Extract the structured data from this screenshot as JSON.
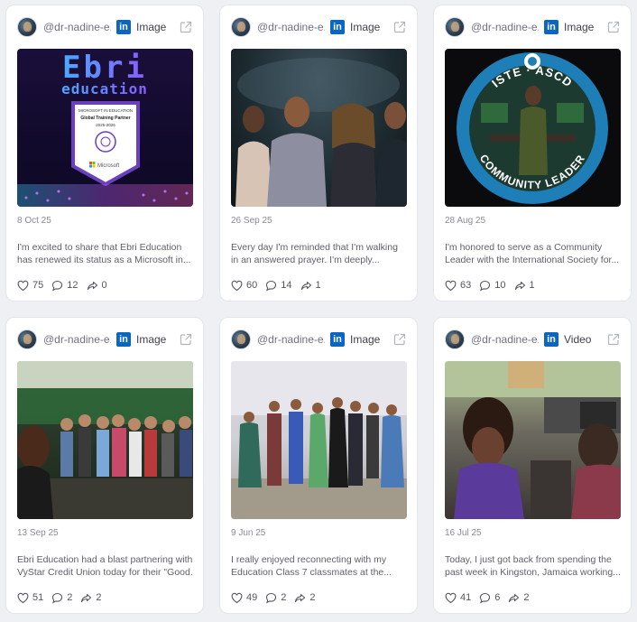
{
  "posts": [
    {
      "handle": "@dr-nadine-e...",
      "platform_icon": "linkedin-icon",
      "type": "Image",
      "media": "ebri",
      "media_text": {
        "brand_line1": "Ebri",
        "brand_line2": "education",
        "badge_top": "MICROSOFT IN EDUCATION",
        "badge_mid": "Global Training Partner",
        "badge_years": "2025-2026",
        "badge_brand": "Microsoft"
      },
      "date": "8 Oct 25",
      "excerpt_line1": "I'm excited to share that Ebri Education",
      "excerpt_line2": "has renewed its status as a Microsoft in...",
      "likes": "75",
      "comments": "12",
      "shares": "0"
    },
    {
      "handle": "@dr-nadine-e...",
      "platform_icon": "linkedin-icon",
      "type": "Image",
      "media": "people",
      "date": "26 Sep 25",
      "excerpt_line1": "Every day I'm reminded that I'm walking",
      "excerpt_line2": "in an answered prayer. I'm deeply...",
      "likes": "60",
      "comments": "14",
      "shares": "1"
    },
    {
      "handle": "@dr-nadine-e...",
      "platform_icon": "linkedin-icon",
      "type": "Image",
      "media": "iste",
      "media_text": {
        "ring_top": "ISTE · ASCD",
        "ring_bottom": "COMMUNITY LEADER"
      },
      "date": "28 Aug 25",
      "excerpt_line1": "I'm honored to serve as a Community",
      "excerpt_line2": "Leader with the International Society for...",
      "likes": "63",
      "comments": "10",
      "shares": "1"
    },
    {
      "handle": "@dr-nadine-e...",
      "platform_icon": "linkedin-icon",
      "type": "Image",
      "media": "party",
      "date": "13 Sep 25",
      "excerpt_line1": "Ebri Education had a blast partnering with",
      "excerpt_line2": "VyStar Credit Union today for their \"Good...",
      "likes": "51",
      "comments": "2",
      "shares": "2"
    },
    {
      "handle": "@dr-nadine-e...",
      "platform_icon": "linkedin-icon",
      "type": "Image",
      "media": "group",
      "date": "9 Jun 25",
      "excerpt_line1": "I really enjoyed reconnecting with my",
      "excerpt_line2": "Education Class 7 classmates at the...",
      "likes": "49",
      "comments": "2",
      "shares": "2"
    },
    {
      "handle": "@dr-nadine-e...",
      "platform_icon": "linkedin-icon",
      "type": "Video",
      "media": "video",
      "date": "16 Jul 25",
      "excerpt_line1": "Today, I just got back from spending the",
      "excerpt_line2": "past week in Kingston, Jamaica working...",
      "likes": "41",
      "comments": "6",
      "shares": "2"
    }
  ],
  "colors": {
    "linkedin": "#0a66c2",
    "card_bg": "#ffffff",
    "page_bg": "#eef0f3",
    "iste_ring": "#1e7fb8"
  }
}
